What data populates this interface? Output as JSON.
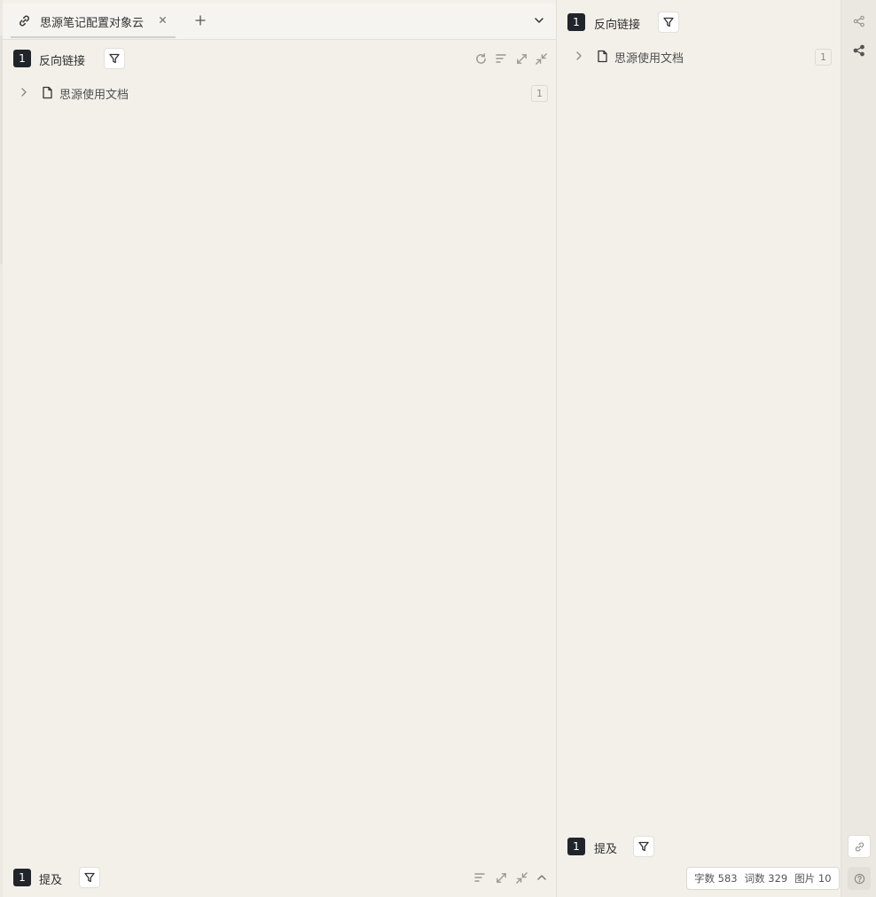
{
  "tabbar": {
    "tab_title": "思源笔记配置对象云",
    "icons": {
      "tab": "link-icon",
      "close": "close-icon",
      "add": "plus-icon",
      "more": "chevron-down-icon"
    }
  },
  "left_panel": {
    "backlinks": {
      "count": "1",
      "title": "反向链接",
      "items": [
        {
          "label": "思源使用文档",
          "count": "1"
        }
      ],
      "toolbar_icons": [
        "refresh-icon",
        "sort-icon",
        "expand-icon",
        "collapse-icon"
      ]
    },
    "mentions": {
      "count": "1",
      "title": "提及",
      "toolbar_icons": [
        "sort-icon",
        "expand-icon",
        "collapse-icon",
        "chevron-up-icon"
      ]
    }
  },
  "right_panel": {
    "backlinks": {
      "count": "1",
      "title": "反向链接",
      "items": [
        {
          "label": "思源使用文档",
          "count": "1"
        }
      ]
    },
    "mentions": {
      "count": "1",
      "title": "提及"
    }
  },
  "status_bar": {
    "chars_label": "字数",
    "chars_value": "583",
    "words_label": "词数",
    "words_value": "329",
    "images_label": "图片",
    "images_value": "10"
  },
  "dock": {
    "icons": [
      "graph-icon",
      "global-graph-icon",
      "backlink-icon",
      "help-icon"
    ]
  },
  "colors": {
    "background": "#f3f0ea",
    "badge": "#21252b",
    "dock": "#ebe8e2"
  }
}
